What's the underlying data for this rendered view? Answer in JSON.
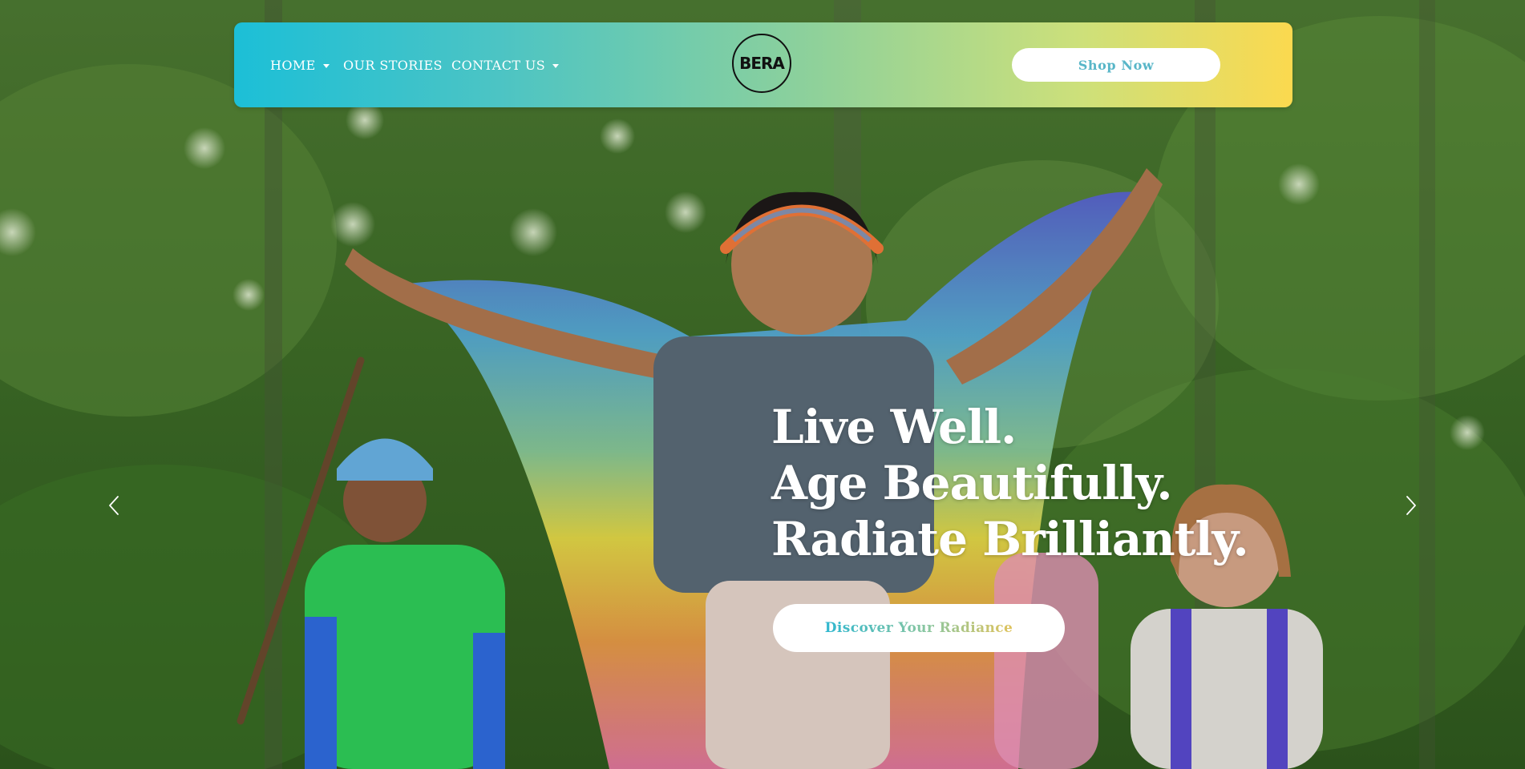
{
  "nav": {
    "home_label": "HOME",
    "stories_label": "OUR STORIES",
    "contact_label": "CONTACT US",
    "logo_text": "BERA",
    "shop_label": "Shop Now"
  },
  "hero": {
    "headline": [
      "Live Well.",
      "Age Beautifully.",
      "Radiate Brilliantly."
    ],
    "cta_label": "Discover Your Radiance"
  },
  "icons": {
    "nav_dropdown": "chevron-down-icon",
    "prev": "chevron-left-icon",
    "next": "chevron-right-icon"
  },
  "colors": {
    "nav_gradient_start": "#1cbfd7",
    "nav_gradient_end": "#fbd94f",
    "shop_text": "#58b6c8"
  }
}
